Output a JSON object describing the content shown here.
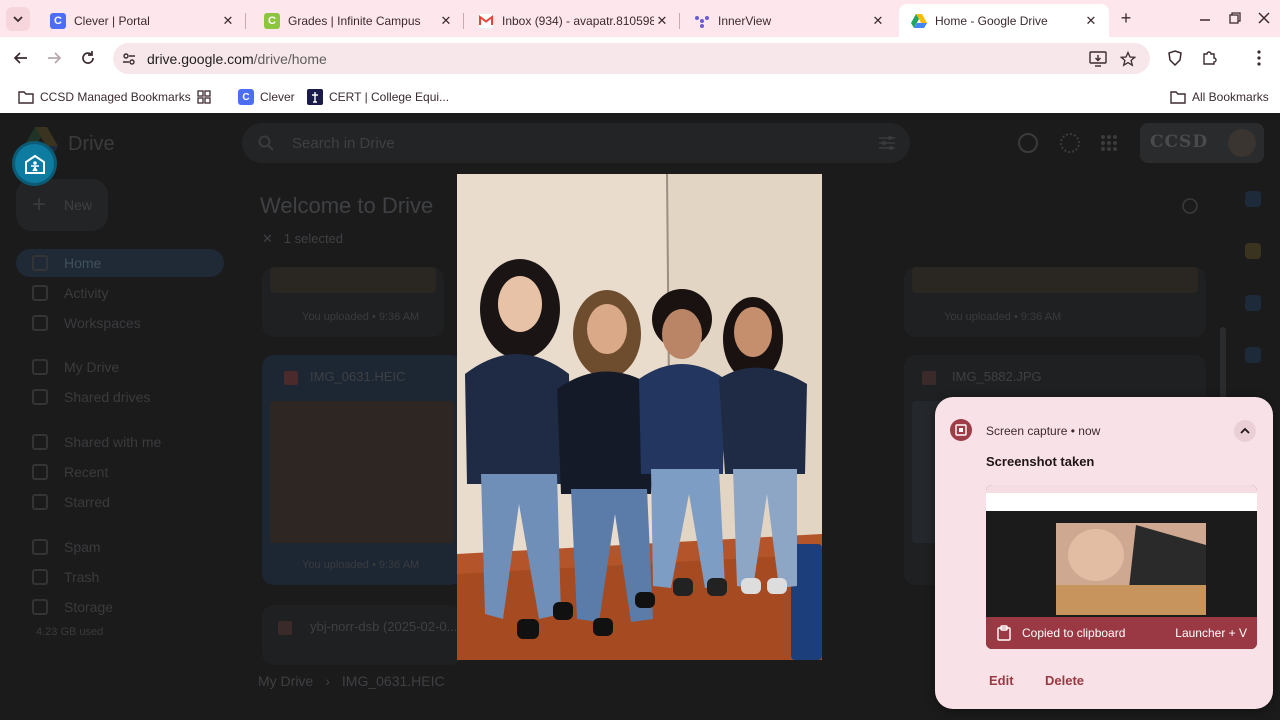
{
  "browser": {
    "tabs": [
      {
        "title": "Clever | Portal",
        "favicon": "clever-icon",
        "color": "#4b6ef5",
        "letter": "C"
      },
      {
        "title": "Grades | Infinite Campus",
        "favicon": "infinite-campus-icon",
        "color": "#8cc63f",
        "letter": "C"
      },
      {
        "title": "Inbox (934) - avapatr.810598",
        "favicon": "gmail-icon",
        "color": "#ea4335",
        "letter": "M"
      },
      {
        "title": "InnerView",
        "favicon": "innerview-icon",
        "color": "#6b5bd6",
        "letter": ""
      },
      {
        "title": "Home - Google Drive",
        "favicon": "google-drive-icon",
        "color": "#1fa463",
        "letter": ""
      }
    ],
    "url_host": "drive.google.com",
    "url_path": "/drive/home",
    "bookmarks": [
      {
        "label": "CCSD Managed Bookmarks",
        "icon": "folder-icon"
      },
      {
        "label": "",
        "icon": "apps-grid-icon"
      },
      {
        "label": "Clever",
        "icon": "clever-icon"
      },
      {
        "label": "CERT | College Equi...",
        "icon": "cert-icon"
      }
    ],
    "all_bookmarks": "All Bookmarks"
  },
  "drive": {
    "brand": "Drive",
    "search_placeholder": "Search in Drive",
    "org_badge": "CCSD",
    "new_label": "New",
    "nav": [
      "Home",
      "Activity",
      "Workspaces",
      "My Drive",
      "Shared drives",
      "Shared with me",
      "Recent",
      "Starred",
      "Spam",
      "Trash",
      "Storage"
    ],
    "storage_used": "4.23 GB used",
    "welcome": "Welcome to Drive",
    "selection": "1 selected",
    "files": [
      {
        "name": "IMG_0631.HEIC",
        "footer": "You uploaded • 9:36 AM"
      },
      {
        "name": "IMG_5882.JPG",
        "footer": "You uploaded • 9:36 AM"
      },
      {
        "name": "ybj-norr-dsb (2025-02-0...",
        "footer": ""
      }
    ],
    "top_row_footer": "You uploaded • 9:36 AM",
    "breadcrumb": {
      "root": "My Drive",
      "file": "IMG_0631.HEIC"
    }
  },
  "notification": {
    "source": "Screen capture",
    "time": "now",
    "title": "Screenshot taken",
    "clipboard": "Copied to clipboard",
    "shortcut": "Launcher + V",
    "edit": "Edit",
    "delete": "Delete",
    "accent": "#9a3944"
  }
}
